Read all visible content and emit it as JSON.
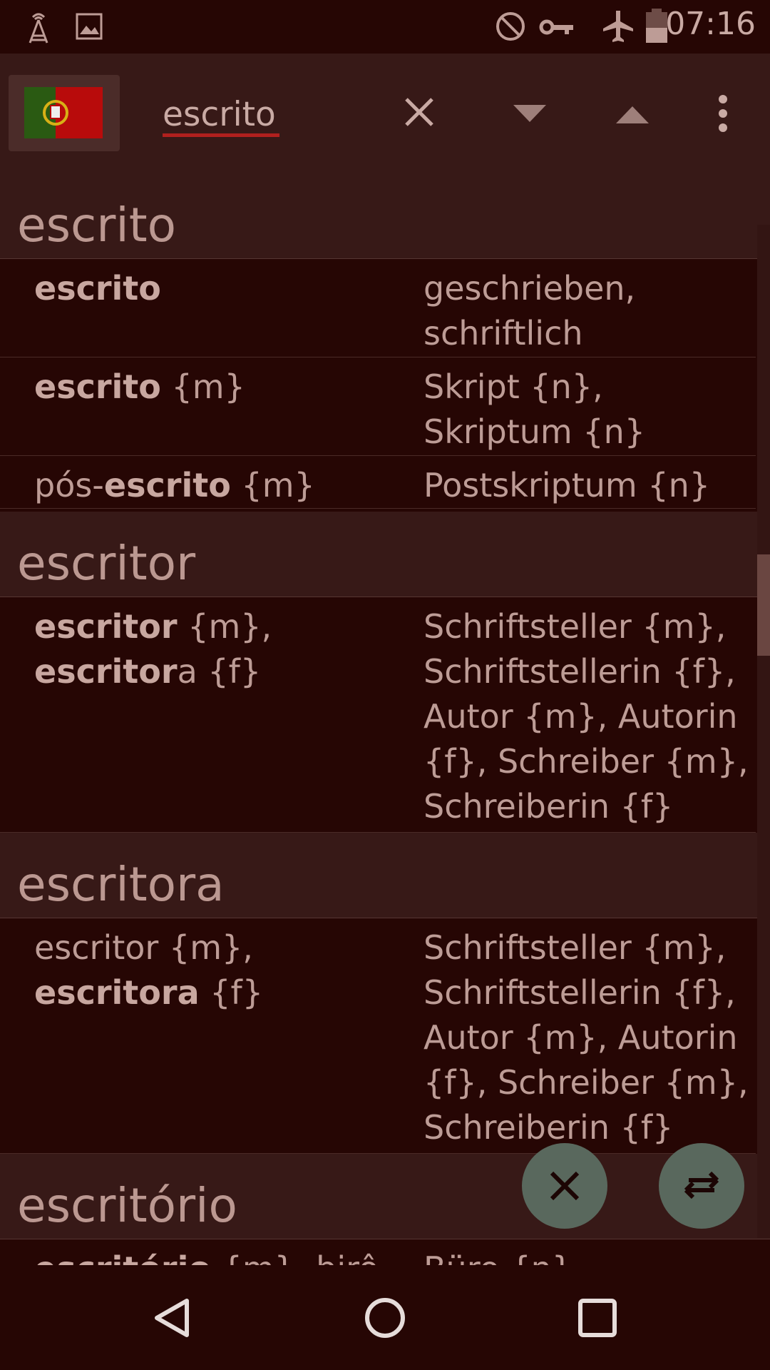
{
  "status_bar": {
    "time": "07:16",
    "icons": [
      "signal-icon",
      "image-icon",
      "do-not-disturb-icon",
      "vpn-key-icon",
      "airplane-mode-icon",
      "battery-icon"
    ]
  },
  "toolbar": {
    "flag_icon": "portugal-flag-icon",
    "search_value": "escrito",
    "clear_icon": "close-icon",
    "next_icon": "triangle-down-icon",
    "prev_icon": "triangle-up-icon",
    "menu_icon": "more-vert-icon"
  },
  "groups": [
    {
      "header": "escrito",
      "rows": [
        {
          "left": [
            {
              "t": "escrito",
              "b": true
            }
          ],
          "right": "geschrieben, schriftlich"
        },
        {
          "left": [
            {
              "t": "escrito",
              "b": true
            },
            {
              "t": " {m}",
              "b": false
            }
          ],
          "right": "Skript {n}, Skriptum {n}"
        },
        {
          "left": [
            {
              "t": "pós-",
              "b": false
            },
            {
              "t": "escrito",
              "b": true
            },
            {
              "t": " {m}",
              "b": false
            }
          ],
          "right": "Postskriptum {n}"
        }
      ]
    },
    {
      "header": "escritor",
      "rows": [
        {
          "left": [
            {
              "t": "escritor",
              "b": true
            },
            {
              "t": " {m},",
              "b": false
            },
            {
              "t": "\n",
              "b": false
            },
            {
              "t": "escritor",
              "b": true
            },
            {
              "t": "a {f}",
              "b": false
            }
          ],
          "right": "Schriftsteller {m}, Schriftstellerin {f}, Autor {m}, Autorin {f}, Schreiber {m}, Schreiberin {f}"
        }
      ]
    },
    {
      "header": "escritora",
      "rows": [
        {
          "left": [
            {
              "t": "escritor {m},",
              "b": false
            },
            {
              "t": "\n",
              "b": false
            },
            {
              "t": "escritora",
              "b": true
            },
            {
              "t": " {f}",
              "b": false
            }
          ],
          "right": "Schriftsteller {m}, Schriftstellerin {f}, Autor {m}, Autorin {f}, Schreiber {m}, Schreiberin {f}"
        }
      ]
    },
    {
      "header": "escritório",
      "rows": [
        {
          "left": [
            {
              "t": "escritório",
              "b": true
            },
            {
              "t": " {m}, birô",
              "b": false
            }
          ],
          "right": "Büro {n}"
        }
      ]
    }
  ],
  "fabs": {
    "clear_icon": "close-icon",
    "swap_icon": "swap-horiz-icon"
  },
  "nav_bar": {
    "icons": [
      "back-icon",
      "home-icon",
      "recents-icon"
    ]
  },
  "colors": {
    "background": "#260604",
    "header_bg": "#371917",
    "accent": "#b0201e",
    "fab": "#59685d"
  }
}
